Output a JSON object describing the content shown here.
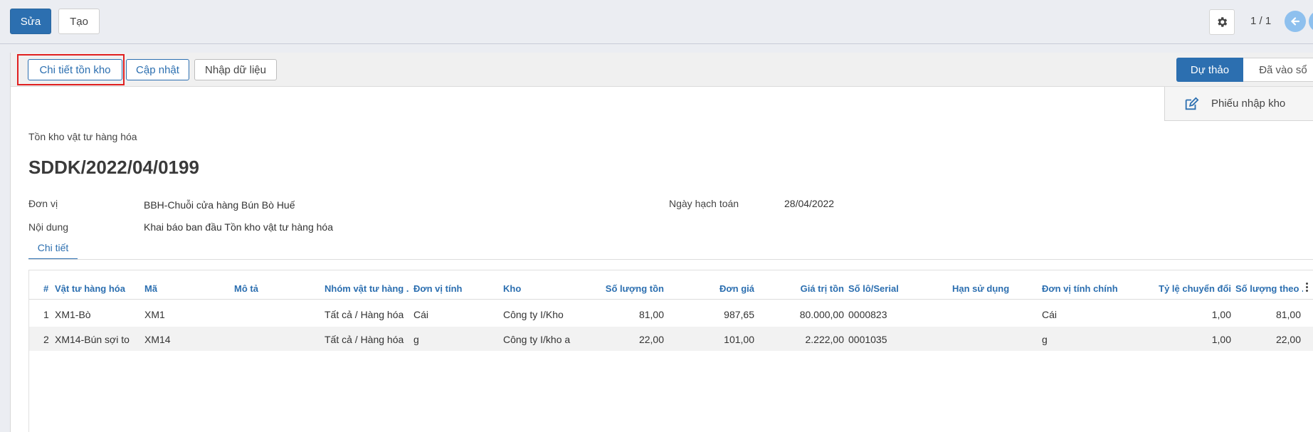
{
  "toolbar": {
    "edit_label": "Sửa",
    "create_label": "Tạo",
    "pager": "1 / 1"
  },
  "statusbar": {
    "btn_detail": "Chi tiết tồn kho",
    "btn_update": "Cập nhật",
    "btn_import": "Nhập dữ liệu",
    "stage_current": "Dự thảo",
    "stage_next": "Đã vào sổ"
  },
  "smart_button": {
    "label": "Phiếu nhập kho",
    "icon": "edit-icon"
  },
  "form": {
    "subtitle": "Tồn kho vật tư hàng hóa",
    "title": "SDDK/2022/04/0199",
    "fields": {
      "unit_label": "Đơn vị",
      "unit_value": "BBH-Chuỗi cửa hàng Bún Bò Huế",
      "content_label": "Nội dung",
      "content_value": "Khai báo ban đầu Tồn kho vật tư hàng hóa",
      "date_label": "Ngày hạch toán",
      "date_value": "28/04/2022"
    }
  },
  "tabs": [
    {
      "label": "Chi tiết",
      "active": true
    }
  ],
  "table": {
    "headers": [
      "#",
      "Vật tư hàng hóa",
      "Mã",
      "Mô tả",
      "Nhóm vật tư hàng ...",
      "Đơn vị tính",
      "Kho",
      "Số lượng tồn",
      "Đơn giá",
      "Giá trị tồn",
      "Số lô/Serial",
      "Hạn sử dụng",
      "Đơn vị tính chính",
      "Tỷ lệ chuyển đổi",
      "Số lượng theo ..."
    ],
    "rows": [
      [
        "1",
        "XM1-Bò",
        "XM1",
        "",
        "Tất cả / Hàng hóa",
        "Cái",
        "Công ty I/Kho",
        "81,00",
        "987,65",
        "80.000,00",
        "0000823",
        "",
        "Cái",
        "1,00",
        "81,00"
      ],
      [
        "2",
        "XM14-Bún sợi to",
        "XM14",
        "",
        "Tất cả / Hàng hóa",
        "g",
        "Công ty I/kho a",
        "22,00",
        "101,00",
        "2.222,00",
        "0001035",
        "",
        "g",
        "1,00",
        "22,00"
      ]
    ]
  },
  "colors": {
    "primary": "#2c6fb0",
    "highlight": "#e02020"
  }
}
